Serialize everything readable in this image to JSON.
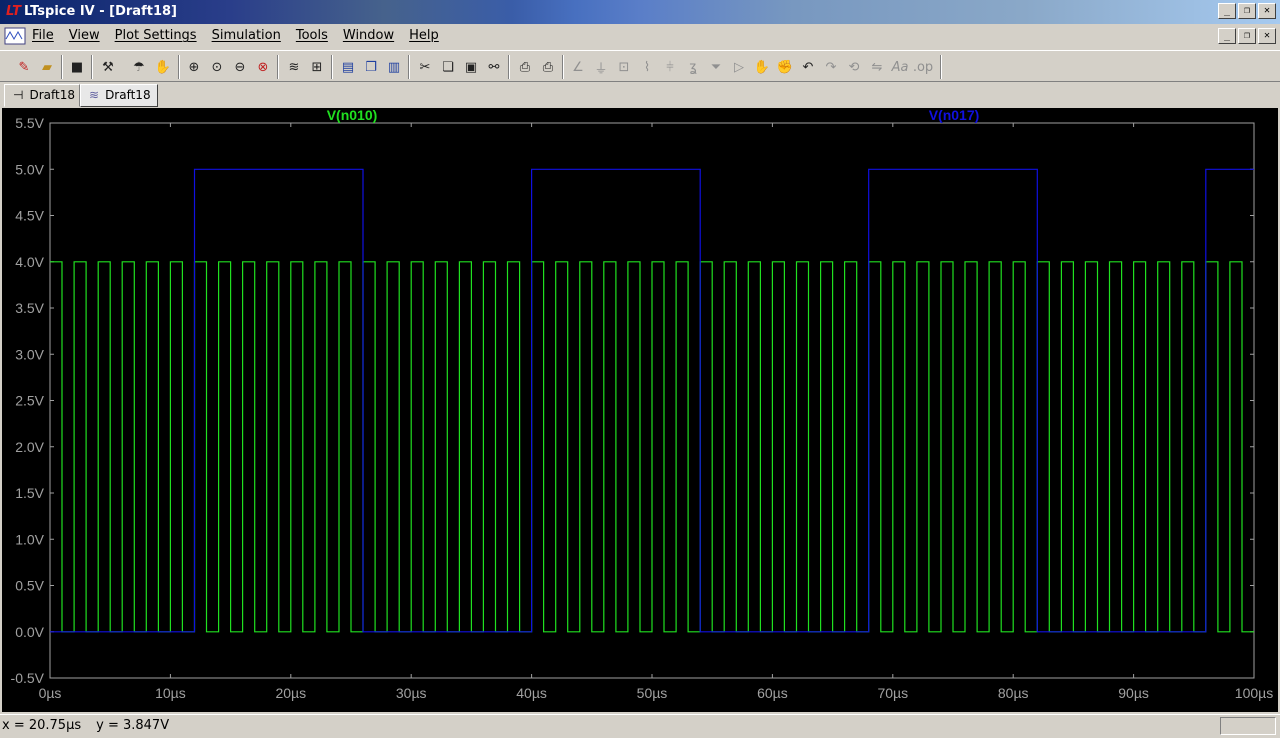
{
  "window": {
    "title": "LTspice IV - [Draft18]"
  },
  "menubar": {
    "items": [
      "File",
      "View",
      "Plot Settings",
      "Simulation",
      "Tools",
      "Window",
      "Help"
    ]
  },
  "toolbar": {
    "icons": [
      "new-schematic-icon",
      "open-icon",
      "save-icon",
      "control-panel-icon",
      "run-icon",
      "pan-hand-icon",
      "zoom-in-icon",
      "zoom-rect-icon",
      "zoom-out-icon",
      "zoom-cancel-icon",
      "autorange-icon",
      "split-icon",
      "tile-horizontal-icon",
      "cascade-icon",
      "tile-vertical-icon",
      "cut-icon",
      "copy-icon",
      "paste-icon",
      "find-icon",
      "print-setup-icon",
      "print-icon",
      "wire-icon",
      "ground-icon",
      "label-icon",
      "resistor-icon",
      "capacitor-icon",
      "inductor-icon",
      "diode-icon",
      "component-icon",
      "move-icon",
      "drag-icon",
      "undo-icon",
      "redo-icon",
      "rotate-icon",
      "mirror-icon",
      "text-icon",
      "spice-directive-icon"
    ]
  },
  "tabs": [
    {
      "label": "Draft18",
      "icon": "schematic-icon",
      "active": false
    },
    {
      "label": "Draft18",
      "icon": "waveform-icon",
      "active": true
    }
  ],
  "chart_data": {
    "type": "line",
    "title": "",
    "xlabel": "",
    "ylabel": "",
    "xlim": [
      0,
      100
    ],
    "ylim": [
      -0.5,
      5.5
    ],
    "x_ticks": [
      "0µs",
      "10µs",
      "20µs",
      "30µs",
      "40µs",
      "50µs",
      "60µs",
      "70µs",
      "80µs",
      "90µs",
      "100µs"
    ],
    "y_ticks": [
      "5.5V",
      "5.0V",
      "4.5V",
      "4.0V",
      "3.5V",
      "3.0V",
      "2.5V",
      "2.0V",
      "1.5V",
      "1.0V",
      "0.5V",
      "0.0V",
      "-0.5V"
    ],
    "background": "#000000",
    "grid": false,
    "series": [
      {
        "name": "V(n010)",
        "color": "#20e020",
        "waveform": "square",
        "period_us": 2,
        "high_v": 4.0,
        "low_v": 0.0,
        "duty": 0.5,
        "start_high": true
      },
      {
        "name": "V(n017)",
        "color": "#1010e0",
        "waveform": "pulse",
        "high_v": 5.0,
        "low_v": 0.0,
        "high_intervals_us": [
          [
            12,
            26
          ],
          [
            40,
            54
          ],
          [
            68,
            82
          ],
          [
            96,
            100
          ]
        ]
      }
    ]
  },
  "status": {
    "x_readout": "x = 20.75µs",
    "y_readout": "y = 3.847V"
  }
}
